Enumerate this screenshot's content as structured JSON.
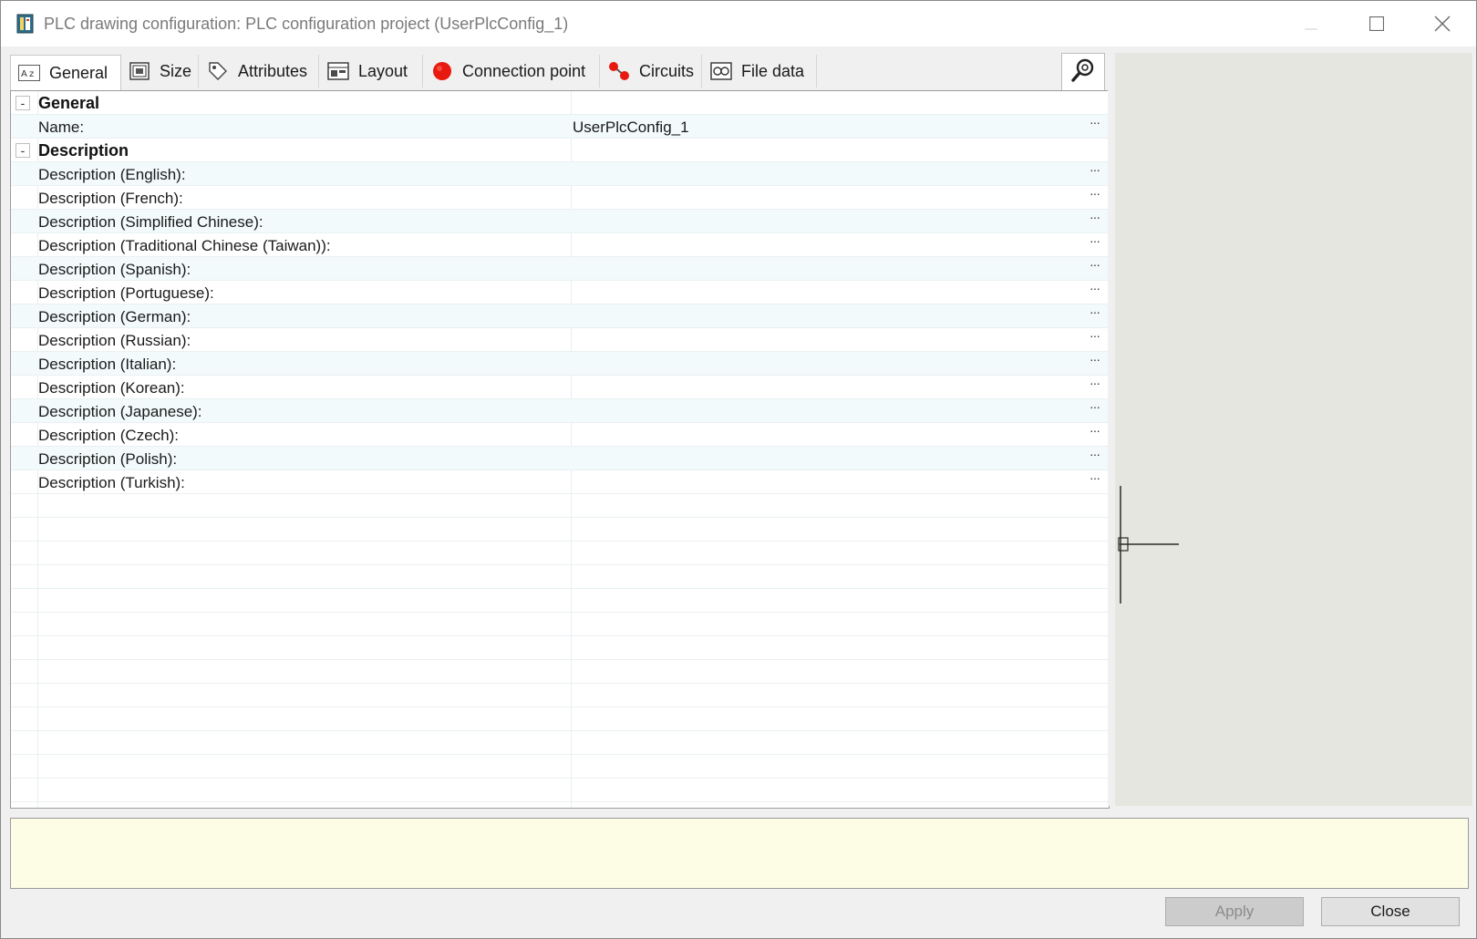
{
  "window": {
    "title": "PLC drawing configuration: PLC configuration project (UserPlcConfig_1)",
    "minimize_icon": "minimize-icon",
    "maximize_icon": "maximize-icon",
    "close_icon": "close-icon"
  },
  "tabs": [
    {
      "label": "General",
      "icon": "text-format-icon",
      "active": true
    },
    {
      "label": "Size",
      "icon": "size-icon",
      "active": false
    },
    {
      "label": "Attributes",
      "icon": "tag-icon",
      "active": false
    },
    {
      "label": "Layout",
      "icon": "layout-icon",
      "active": false
    },
    {
      "label": "Connection point",
      "icon": "red-dot-icon",
      "active": false
    },
    {
      "label": "Circuits",
      "icon": "circuit-icon",
      "active": false
    },
    {
      "label": "File data",
      "icon": "file-data-icon",
      "active": false
    }
  ],
  "toolbar": {
    "search_icon": "search-icon"
  },
  "grid": {
    "general": {
      "category": "General",
      "toggle": "-",
      "name_label": "Name:",
      "name_value": "UserPlcConfig_1"
    },
    "description": {
      "category": "Description",
      "toggle": "-",
      "rows": [
        "Description (English):",
        "Description (French):",
        "Description (Simplified Chinese):",
        "Description (Traditional Chinese (Taiwan)):",
        "Description (Spanish):",
        "Description (Portuguese):",
        "Description (German):",
        "Description (Russian):",
        "Description (Italian):",
        "Description (Korean):",
        "Description (Japanese):",
        "Description (Czech):",
        "Description (Polish):",
        "Description (Turkish):"
      ]
    },
    "ellipsis": "···"
  },
  "buttons": {
    "apply": "Apply",
    "close": "Close"
  },
  "colors": {
    "preview_bg": "#e6e6e0",
    "message_bg": "#fdfde6",
    "row_alt": "#f2fafb",
    "accent_red": "#e8190e"
  }
}
